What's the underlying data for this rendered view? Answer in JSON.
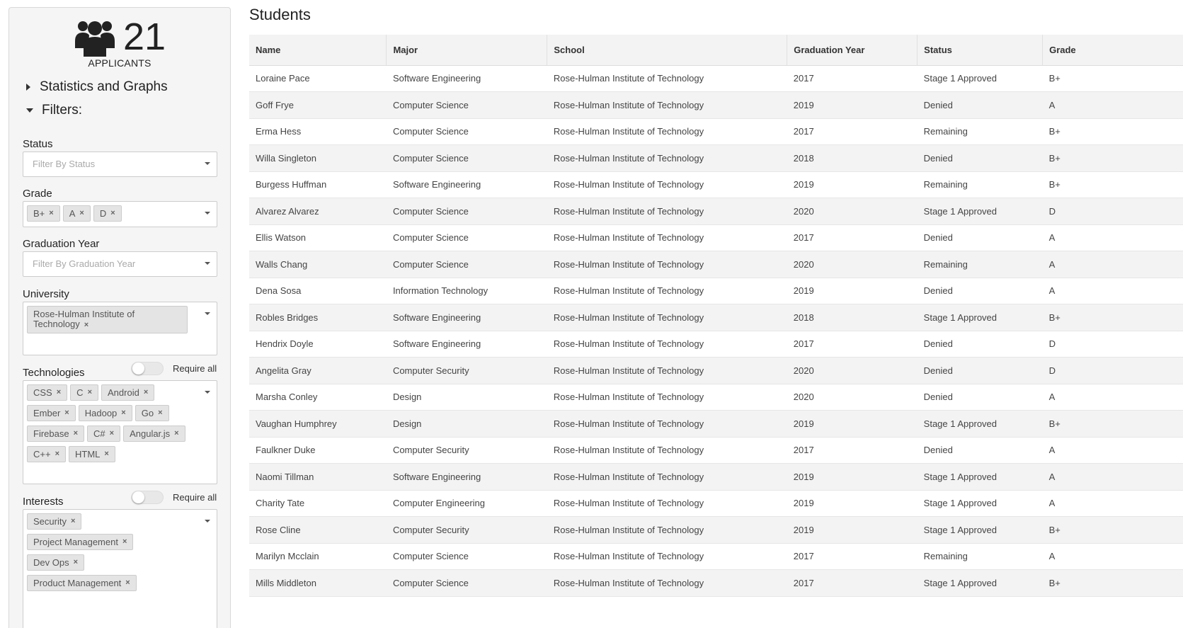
{
  "sidebar": {
    "count": "21",
    "count_label": "APPLICANTS",
    "stats_toggle": "Statistics and Graphs",
    "filters_toggle": "Filters:",
    "status": {
      "label": "Status",
      "placeholder": "Filter By Status"
    },
    "grade": {
      "label": "Grade",
      "tags": [
        "B+",
        "A",
        "D"
      ]
    },
    "graduation_year": {
      "label": "Graduation Year",
      "placeholder": "Filter By Graduation Year"
    },
    "university": {
      "label": "University",
      "tags": [
        "Rose-Hulman Institute of Technology"
      ]
    },
    "technologies": {
      "label": "Technologies",
      "require_all": "Require all",
      "tags": [
        "CSS",
        "C",
        "Android",
        "Ember",
        "Hadoop",
        "Go",
        "Firebase",
        "C#",
        "Angular.js",
        "C++",
        "HTML"
      ]
    },
    "interests": {
      "label": "Interests",
      "require_all": "Require all",
      "tags": [
        "Security",
        "Project Management",
        "Dev Ops",
        "Product Management"
      ]
    }
  },
  "main": {
    "title": "Students",
    "columns": [
      "Name",
      "Major",
      "School",
      "Graduation Year",
      "Status",
      "Grade"
    ],
    "rows": [
      [
        "Loraine Pace",
        "Software Engineering",
        "Rose-Hulman Institute of Technology",
        "2017",
        "Stage 1 Approved",
        "B+"
      ],
      [
        "Goff Frye",
        "Computer Science",
        "Rose-Hulman Institute of Technology",
        "2019",
        "Denied",
        "A"
      ],
      [
        "Erma Hess",
        "Computer Science",
        "Rose-Hulman Institute of Technology",
        "2017",
        "Remaining",
        "B+"
      ],
      [
        "Willa Singleton",
        "Computer Science",
        "Rose-Hulman Institute of Technology",
        "2018",
        "Denied",
        "B+"
      ],
      [
        "Burgess Huffman",
        "Software Engineering",
        "Rose-Hulman Institute of Technology",
        "2019",
        "Remaining",
        "B+"
      ],
      [
        "Alvarez Alvarez",
        "Computer Science",
        "Rose-Hulman Institute of Technology",
        "2020",
        "Stage 1 Approved",
        "D"
      ],
      [
        "Ellis Watson",
        "Computer Science",
        "Rose-Hulman Institute of Technology",
        "2017",
        "Denied",
        "A"
      ],
      [
        "Walls Chang",
        "Computer Science",
        "Rose-Hulman Institute of Technology",
        "2020",
        "Remaining",
        "A"
      ],
      [
        "Dena Sosa",
        "Information Technology",
        "Rose-Hulman Institute of Technology",
        "2019",
        "Denied",
        "A"
      ],
      [
        "Robles Bridges",
        "Software Engineering",
        "Rose-Hulman Institute of Technology",
        "2018",
        "Stage 1 Approved",
        "B+"
      ],
      [
        "Hendrix Doyle",
        "Software Engineering",
        "Rose-Hulman Institute of Technology",
        "2017",
        "Denied",
        "D"
      ],
      [
        "Angelita Gray",
        "Computer Security",
        "Rose-Hulman Institute of Technology",
        "2020",
        "Denied",
        "D"
      ],
      [
        "Marsha Conley",
        "Design",
        "Rose-Hulman Institute of Technology",
        "2020",
        "Denied",
        "A"
      ],
      [
        "Vaughan Humphrey",
        "Design",
        "Rose-Hulman Institute of Technology",
        "2019",
        "Stage 1 Approved",
        "B+"
      ],
      [
        "Faulkner Duke",
        "Computer Security",
        "Rose-Hulman Institute of Technology",
        "2017",
        "Denied",
        "A"
      ],
      [
        "Naomi Tillman",
        "Software Engineering",
        "Rose-Hulman Institute of Technology",
        "2019",
        "Stage 1 Approved",
        "A"
      ],
      [
        "Charity Tate",
        "Computer Engineering",
        "Rose-Hulman Institute of Technology",
        "2019",
        "Stage 1 Approved",
        "A"
      ],
      [
        "Rose Cline",
        "Computer Security",
        "Rose-Hulman Institute of Technology",
        "2019",
        "Stage 1 Approved",
        "B+"
      ],
      [
        "Marilyn Mcclain",
        "Computer Science",
        "Rose-Hulman Institute of Technology",
        "2017",
        "Remaining",
        "A"
      ],
      [
        "Mills Middleton",
        "Computer Science",
        "Rose-Hulman Institute of Technology",
        "2017",
        "Stage 1 Approved",
        "B+"
      ]
    ]
  }
}
